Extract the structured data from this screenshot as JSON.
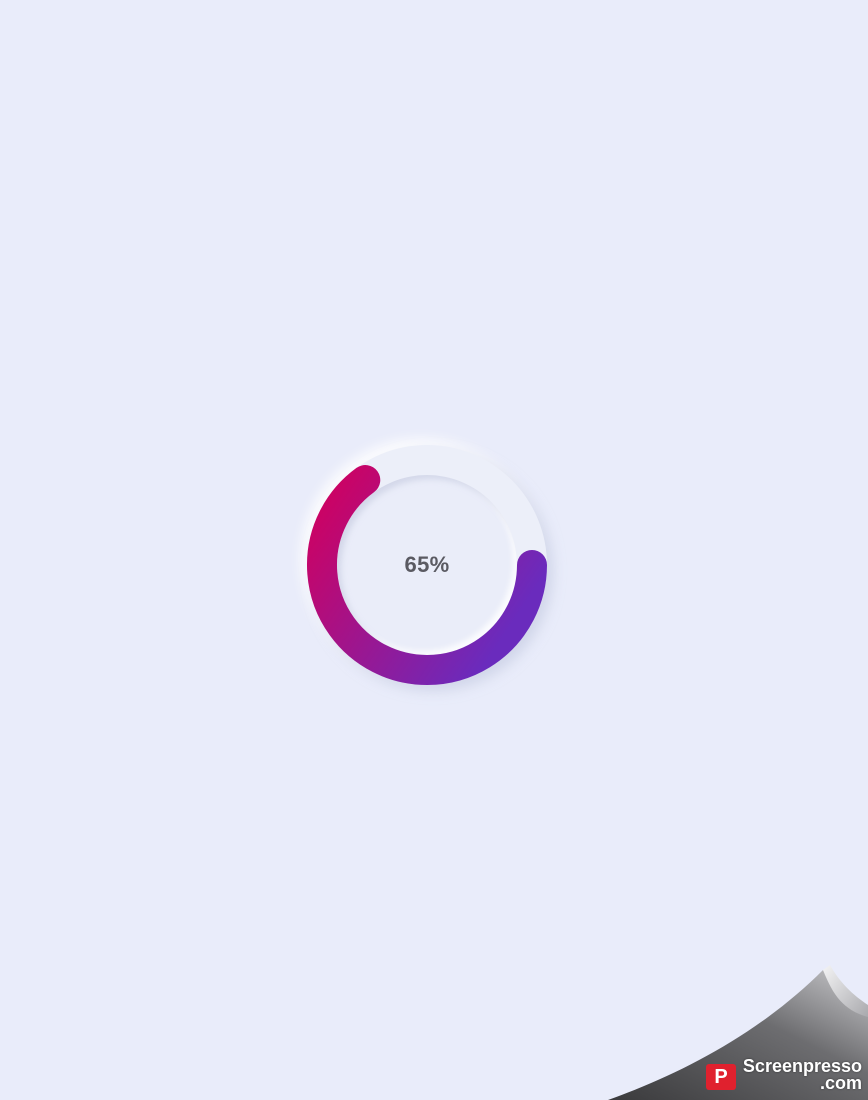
{
  "progress": {
    "value": 0.65,
    "label": "65%",
    "gradient_start_color": "#d1005f",
    "gradient_end_color": "#6a2bbd",
    "track_color": "#eceff9"
  },
  "watermark": {
    "logo_letter": "P",
    "brand_line1": "Screenpresso",
    "brand_line2": ".com",
    "logo_color": "#e0212e"
  }
}
